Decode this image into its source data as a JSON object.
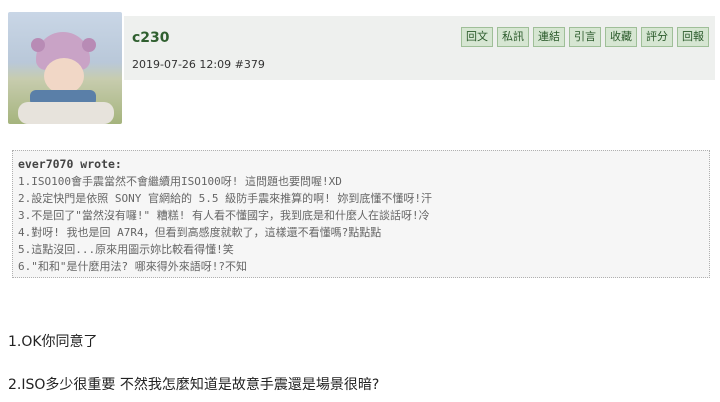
{
  "post": {
    "username": "c230",
    "timestamp": "2019-07-26 12:09",
    "post_number": "#379",
    "actions": [
      "回文",
      "私訊",
      "連結",
      "引言",
      "收藏",
      "評分",
      "回報"
    ]
  },
  "quote": {
    "author": "ever7070 wrote:",
    "lines": [
      "1.ISO100會手震當然不會繼續用ISO100呀! 這問題也要問喔!XD",
      "2.設定快門是依照 SONY 官網給的 5.5 級防手震來推算的啊! 妳到底懂不懂呀!汗",
      "3.不是回了\"當然沒有囉!\" 糟糕! 有人看不懂國字，我到底是和什麼人在談話呀!冷",
      "4.對呀! 我也是回 A7R4，但看到高感度就軟了，這樣還不看懂嗎?點點點",
      "5.這點沒回...原來用圖示妳比較看得懂!笑",
      "6.\"和和\"是什麼用法? 哪來得外來語呀!?不知"
    ]
  },
  "replies": [
    "1.OK你同意了",
    "2.ISO多少很重要 不然我怎麼知道是故意手震還是場景很暗?"
  ]
}
